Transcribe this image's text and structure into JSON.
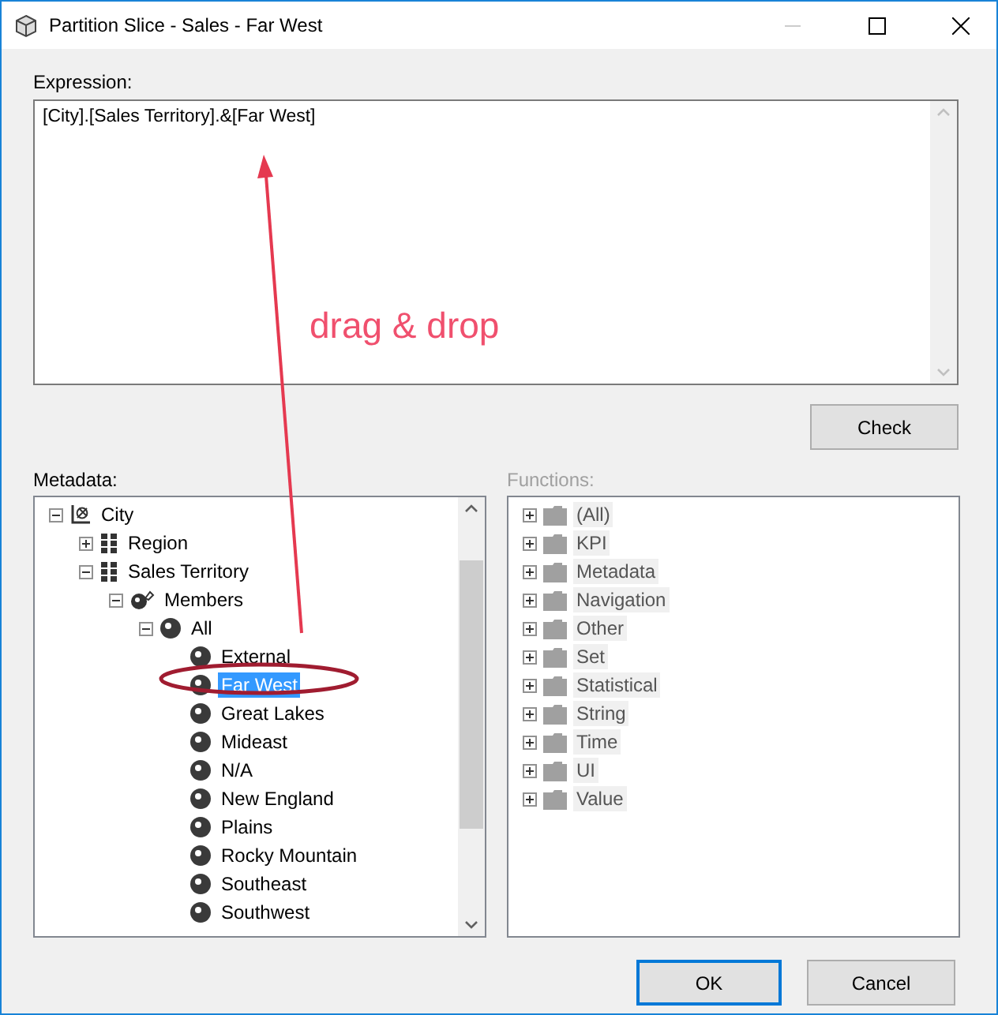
{
  "window": {
    "title": "Partition Slice - Sales - Far West"
  },
  "expression": {
    "label": "Expression:",
    "value": "[City].[Sales Territory].&[Far West]"
  },
  "annotation": {
    "text": "drag & drop"
  },
  "check_button": "Check",
  "metadata": {
    "label": "Metadata:",
    "tree": [
      {
        "label": "City",
        "kind": "dimension",
        "selected": false,
        "expanded": true,
        "children": [
          {
            "label": "Region",
            "kind": "hierarchy",
            "selected": false,
            "expanded": false
          },
          {
            "label": "Sales Territory",
            "kind": "hierarchy",
            "selected": false,
            "expanded": true,
            "children": [
              {
                "label": "Members",
                "kind": "members",
                "selected": false,
                "expanded": true,
                "children": [
                  {
                    "label": "All",
                    "kind": "member",
                    "selected": false,
                    "expanded": true,
                    "children": [
                      {
                        "label": "External",
                        "kind": "member",
                        "selected": false
                      },
                      {
                        "label": "Far West",
                        "kind": "member",
                        "selected": true
                      },
                      {
                        "label": "Great Lakes",
                        "kind": "member",
                        "selected": false
                      },
                      {
                        "label": "Mideast",
                        "kind": "member",
                        "selected": false
                      },
                      {
                        "label": "N/A",
                        "kind": "member",
                        "selected": false
                      },
                      {
                        "label": "New England",
                        "kind": "member",
                        "selected": false
                      },
                      {
                        "label": "Plains",
                        "kind": "member",
                        "selected": false
                      },
                      {
                        "label": "Rocky Mountain",
                        "kind": "member",
                        "selected": false
                      },
                      {
                        "label": "Southeast",
                        "kind": "member",
                        "selected": false
                      },
                      {
                        "label": "Southwest",
                        "kind": "member",
                        "selected": false
                      }
                    ]
                  }
                ]
              }
            ]
          }
        ]
      }
    ]
  },
  "functions": {
    "label": "Functions:",
    "disabled": true,
    "items": [
      {
        "label": "(All)",
        "expanded": false
      },
      {
        "label": "KPI",
        "expanded": false
      },
      {
        "label": "Metadata",
        "expanded": false
      },
      {
        "label": "Navigation",
        "expanded": false
      },
      {
        "label": "Other",
        "expanded": false
      },
      {
        "label": "Set",
        "expanded": false
      },
      {
        "label": "Statistical",
        "expanded": false
      },
      {
        "label": "String",
        "expanded": false
      },
      {
        "label": "Time",
        "expanded": false
      },
      {
        "label": "UI",
        "expanded": false
      },
      {
        "label": "Value",
        "expanded": false
      }
    ]
  },
  "buttons": [
    {
      "label": "OK",
      "default": true
    },
    {
      "label": "Cancel",
      "default": false
    }
  ]
}
